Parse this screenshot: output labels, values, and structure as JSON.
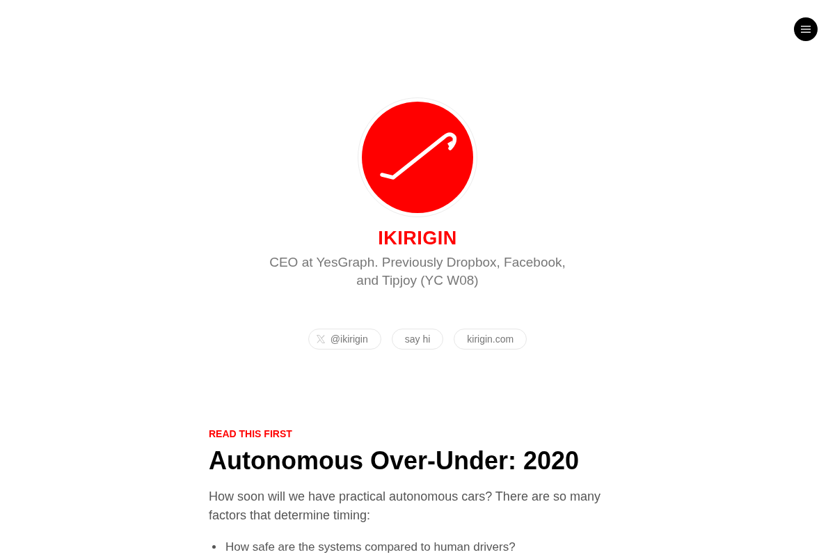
{
  "profile": {
    "name": "IKIRIGIN",
    "bio": "CEO at YesGraph. Previously Dropbox, Facebook, and Tipjoy (YC W08)"
  },
  "links": [
    {
      "kind": "x",
      "label": "@ikirigin"
    },
    {
      "kind": "plain",
      "label": "say hi"
    },
    {
      "kind": "plain",
      "label": "kirigin.com"
    }
  ],
  "post": {
    "eyebrow": "READ THIS FIRST",
    "title": "Autonomous Over-Under: 2020",
    "intro": "How soon will we have practical autonomous cars? There are so many factors that determine timing:",
    "bullets": [
      "How safe are the systems compared to human drivers?"
    ]
  }
}
